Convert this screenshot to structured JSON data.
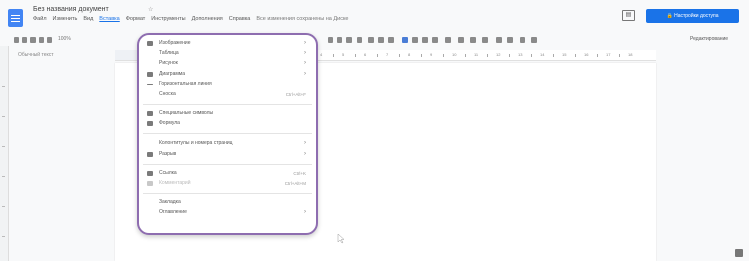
{
  "header": {
    "doc_title": "Без названия документ",
    "title_extra": "☆",
    "menu": [
      "Файл",
      "Изменить",
      "Вид",
      "Вставка",
      "Формат",
      "Инструменты",
      "Дополнения",
      "Справка"
    ],
    "saved_note": "Все изменения сохранены на Диске",
    "comments_icon": "comments-icon",
    "share_label": "Настройки доступа"
  },
  "toolbar": {
    "zoom": "100%",
    "editing_mode": "Редактирование"
  },
  "styles_dropdown": "Обычный текст",
  "ruler": {
    "numbers": [
      "1",
      "2",
      "3",
      "4",
      "5",
      "6",
      "7",
      "8",
      "9",
      "10",
      "11",
      "12",
      "13",
      "14",
      "15",
      "16",
      "17",
      "18"
    ]
  },
  "insert_menu": {
    "items": [
      {
        "label": "Изображение",
        "submenu": true,
        "icon": "image-icon"
      },
      {
        "label": "Таблица",
        "submenu": true
      },
      {
        "label": "Рисунок",
        "submenu": true
      },
      {
        "label": "Диаграмма",
        "submenu": true,
        "icon": "chart-icon"
      },
      {
        "label": "Горизонтальная линия",
        "icon": "horizontal-line-icon"
      },
      {
        "label": "Сноска",
        "shortcut": "Ctrl+Alt+F"
      },
      {
        "label": "Специальные символы",
        "icon": "omega-icon"
      },
      {
        "label": "Формула",
        "icon": "pi-icon"
      },
      {
        "label": "Колонтитулы и номера страниц",
        "submenu": true
      },
      {
        "label": "Разрыв",
        "submenu": true,
        "icon": "break-icon"
      },
      {
        "label": "Ссылка",
        "shortcut": "Ctrl+K",
        "icon": "link-icon"
      },
      {
        "label": "Комментарий",
        "shortcut": "Ctrl+Alt+M",
        "disabled": true,
        "icon": "comment-icon"
      },
      {
        "label": "Закладка"
      },
      {
        "label": "Оглавление",
        "submenu": true
      }
    ]
  },
  "colors": {
    "accent": "#1a73e8",
    "menu_highlight": "#8e6db0"
  }
}
